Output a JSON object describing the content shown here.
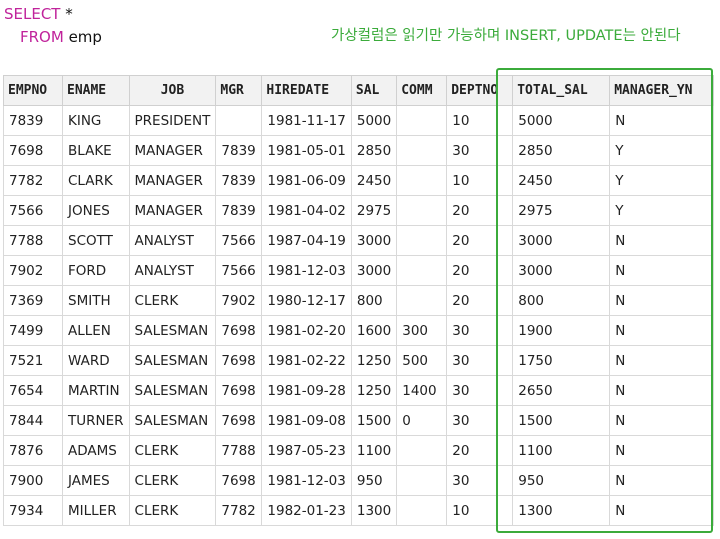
{
  "query": {
    "select_kw": "SELECT",
    "select_rest": " *",
    "from_kw": "FROM",
    "from_rest": " emp"
  },
  "note": "가상컬럼은 읽기만 가능하며 INSERT, UPDATE는 안된다",
  "table": {
    "headers": [
      "EMPNO",
      "ENAME",
      "JOB",
      "MGR",
      "HIREDATE",
      "SAL",
      "COMM",
      "DEPTNO",
      "TOTAL_SAL",
      "MANAGER_YN"
    ],
    "rows": [
      [
        "7839",
        "KING",
        "PRESIDENT",
        "",
        "1981-11-17",
        "5000",
        "",
        "10",
        "5000",
        "N"
      ],
      [
        "7698",
        "BLAKE",
        "MANAGER",
        "7839",
        "1981-05-01",
        "2850",
        "",
        "30",
        "2850",
        "Y"
      ],
      [
        "7782",
        "CLARK",
        "MANAGER",
        "7839",
        "1981-06-09",
        "2450",
        "",
        "10",
        "2450",
        "Y"
      ],
      [
        "7566",
        "JONES",
        "MANAGER",
        "7839",
        "1981-04-02",
        "2975",
        "",
        "20",
        "2975",
        "Y"
      ],
      [
        "7788",
        "SCOTT",
        "ANALYST",
        "7566",
        "1987-04-19",
        "3000",
        "",
        "20",
        "3000",
        "N"
      ],
      [
        "7902",
        "FORD",
        "ANALYST",
        "7566",
        "1981-12-03",
        "3000",
        "",
        "20",
        "3000",
        "N"
      ],
      [
        "7369",
        "SMITH",
        "CLERK",
        "7902",
        "1980-12-17",
        "800",
        "",
        "20",
        "800",
        "N"
      ],
      [
        "7499",
        "ALLEN",
        "SALESMAN",
        "7698",
        "1981-02-20",
        "1600",
        "300",
        "30",
        "1900",
        "N"
      ],
      [
        "7521",
        "WARD",
        "SALESMAN",
        "7698",
        "1981-02-22",
        "1250",
        "500",
        "30",
        "1750",
        "N"
      ],
      [
        "7654",
        "MARTIN",
        "SALESMAN",
        "7698",
        "1981-09-28",
        "1250",
        "1400",
        "30",
        "2650",
        "N"
      ],
      [
        "7844",
        "TURNER",
        "SALESMAN",
        "7698",
        "1981-09-08",
        "1500",
        "0",
        "30",
        "1500",
        "N"
      ],
      [
        "7876",
        "ADAMS",
        "CLERK",
        "7788",
        "1987-05-23",
        "1100",
        "",
        "20",
        "1100",
        "N"
      ],
      [
        "7900",
        "JAMES",
        "CLERK",
        "7698",
        "1981-12-03",
        "950",
        "",
        "30",
        "950",
        "N"
      ],
      [
        "7934",
        "MILLER",
        "CLERK",
        "7782",
        "1982-01-23",
        "1300",
        "",
        "10",
        "1300",
        "N"
      ]
    ]
  },
  "colors": {
    "keyword": "#c0239b",
    "annotation": "#3bab3b",
    "header_bg": "#f2f2f2"
  }
}
